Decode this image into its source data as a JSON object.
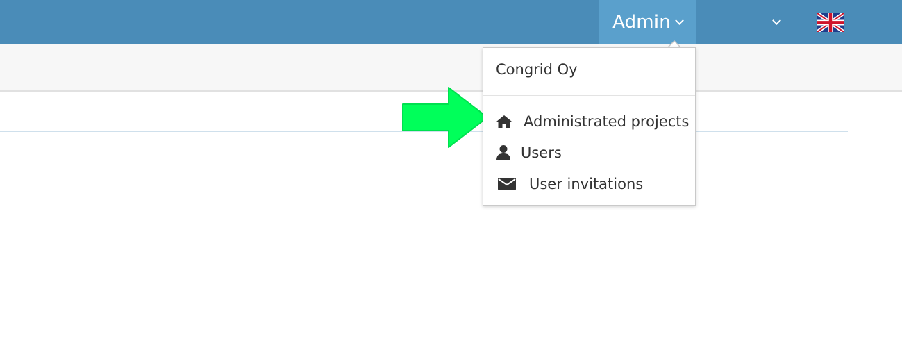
{
  "header": {
    "admin_label": "Admin",
    "language": "English"
  },
  "dropdown": {
    "company": "Congrid Oy",
    "items": [
      {
        "label": "Administrated projects",
        "icon": "home-icon"
      },
      {
        "label": "Users",
        "icon": "user-icon"
      },
      {
        "label": "User invitations",
        "icon": "envelope-icon"
      }
    ]
  },
  "colors": {
    "topbar": "#4a8cb8",
    "admin_active": "#5aa0cc",
    "arrow": "#00ff5a"
  }
}
